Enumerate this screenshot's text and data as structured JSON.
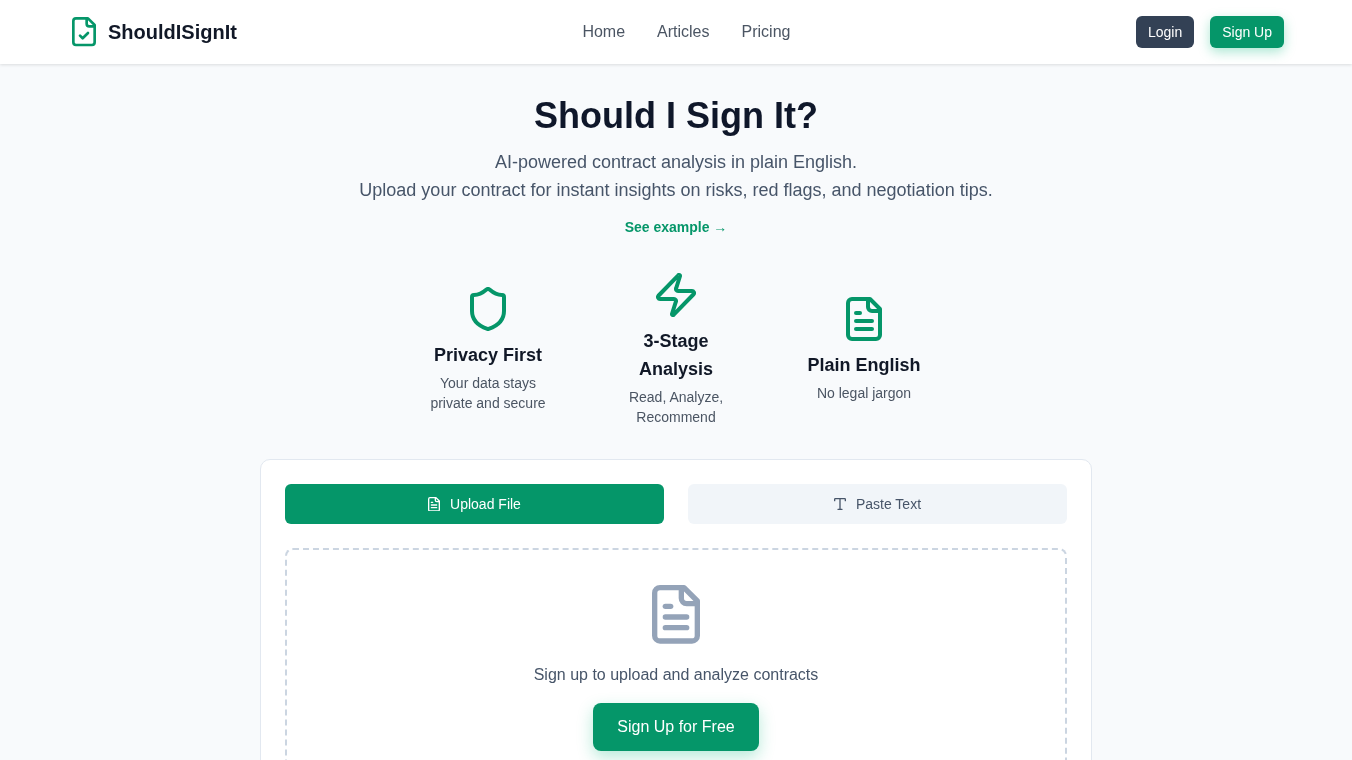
{
  "header": {
    "brand": "ShouldISignIt",
    "nav": [
      "Home",
      "Articles",
      "Pricing"
    ],
    "login": "Login",
    "signup": "Sign Up"
  },
  "hero": {
    "title": "Should I Sign It?",
    "subtitle": [
      "AI-powered contract analysis in plain English.",
      "Upload your contract for instant insights on risks, red flags, and negotiation tips."
    ],
    "example_link": "See example →"
  },
  "features": [
    {
      "title": "Privacy First",
      "description": "Your data stays private and secure"
    },
    {
      "title": "3-Stage Analysis",
      "description": "Read, Analyze, Recommend"
    },
    {
      "title": "Plain English",
      "description": "No legal jargon"
    }
  ],
  "upload_card": {
    "tabs": [
      {
        "label": "Upload File",
        "selected": true
      },
      {
        "label": "Paste Text",
        "selected": false
      }
    ],
    "dropzone": {
      "message": "Sign up to upload and analyze contracts",
      "button": "Sign Up for Free"
    }
  }
}
